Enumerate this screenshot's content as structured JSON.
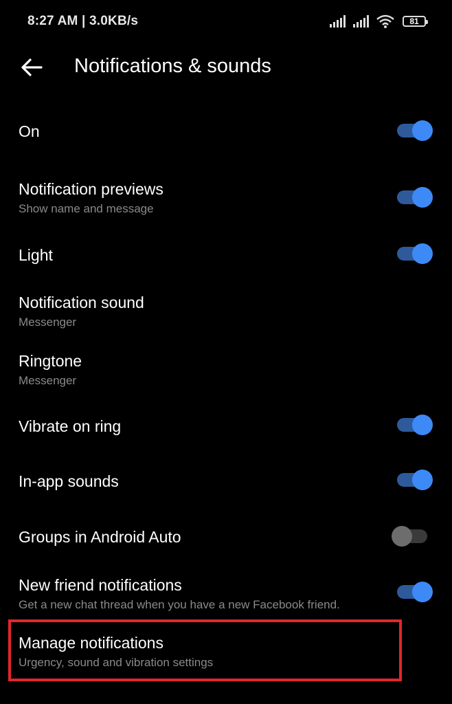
{
  "status_bar": {
    "time_speed": "8:27 AM | 3.0KB/s",
    "battery": "81",
    "icons": [
      "signal-icon",
      "signal-icon",
      "wifi-icon",
      "battery-icon"
    ]
  },
  "header": {
    "back_icon": "arrow-left-icon",
    "title": "Notifications & sounds"
  },
  "settings": [
    {
      "label": "On",
      "sub": "",
      "toggle": "on"
    },
    {
      "label": "Notification previews",
      "sub": "Show name and message",
      "toggle": "on"
    },
    {
      "label": "Light",
      "sub": "",
      "toggle": "on"
    },
    {
      "label": "Notification sound",
      "sub": "Messenger",
      "toggle": "none"
    },
    {
      "label": "Ringtone",
      "sub": "Messenger",
      "toggle": "none"
    },
    {
      "label": "Vibrate on ring",
      "sub": "",
      "toggle": "on"
    },
    {
      "label": "In-app sounds",
      "sub": "",
      "toggle": "on"
    },
    {
      "label": "Groups in Android Auto",
      "sub": "",
      "toggle": "off"
    },
    {
      "label": "New friend notifications",
      "sub": "Get a new chat thread when you have a new Facebook friend.",
      "toggle": "on"
    },
    {
      "label": "Manage notifications",
      "sub": "Urgency, sound and vibration settings",
      "toggle": "none"
    }
  ],
  "colors": {
    "background": "#000000",
    "toggle_on_knob": "#3d8af7",
    "toggle_on_track": "#2e5a9c",
    "toggle_off_knob": "#6d6d6d",
    "highlight": "#e3262b"
  }
}
